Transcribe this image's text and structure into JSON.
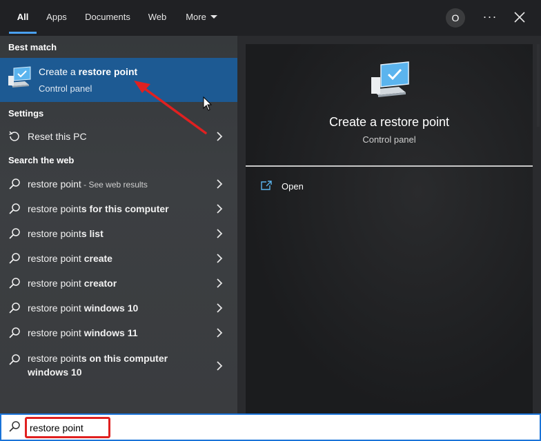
{
  "tabs": [
    {
      "label": "All",
      "active": true
    },
    {
      "label": "Apps",
      "active": false
    },
    {
      "label": "Documents",
      "active": false
    },
    {
      "label": "Web",
      "active": false
    },
    {
      "label": "More",
      "active": false
    }
  ],
  "header": {
    "avatar_initial": "O",
    "more_options": "···"
  },
  "left": {
    "best_match_label": "Best match",
    "best_match": {
      "title_prefix": "Create a ",
      "title_bold": "restore point",
      "subtitle": "Control panel",
      "icon": "computer-check-icon"
    },
    "settings_label": "Settings",
    "settings_item": {
      "label": "Reset this PC",
      "icon": "reset-icon"
    },
    "web_label": "Search the web",
    "web_items": [
      {
        "query": "restore point",
        "suffix": "",
        "hint": " - See web results"
      },
      {
        "query": "restore point",
        "suffix": "s for this computer",
        "hint": ""
      },
      {
        "query": "restore point",
        "suffix": "s list",
        "hint": ""
      },
      {
        "query": "restore point",
        "suffix": " create",
        "hint": ""
      },
      {
        "query": "restore point",
        "suffix": " creator",
        "hint": ""
      },
      {
        "query": "restore point",
        "suffix": " windows 10",
        "hint": ""
      },
      {
        "query": "restore point",
        "suffix": " windows 11",
        "hint": ""
      },
      {
        "query": "restore point",
        "suffix": "s on this computer windows 10",
        "hint": ""
      }
    ]
  },
  "preview": {
    "title": "Create a restore point",
    "subtitle": "Control panel",
    "action_open": "Open",
    "icon": "computer-check-icon"
  },
  "search": {
    "value": "restore point",
    "icon": "search-icon"
  },
  "colors": {
    "accent": "#1a73d8",
    "selection": "#1d5a93",
    "annotation": "#e02020"
  }
}
